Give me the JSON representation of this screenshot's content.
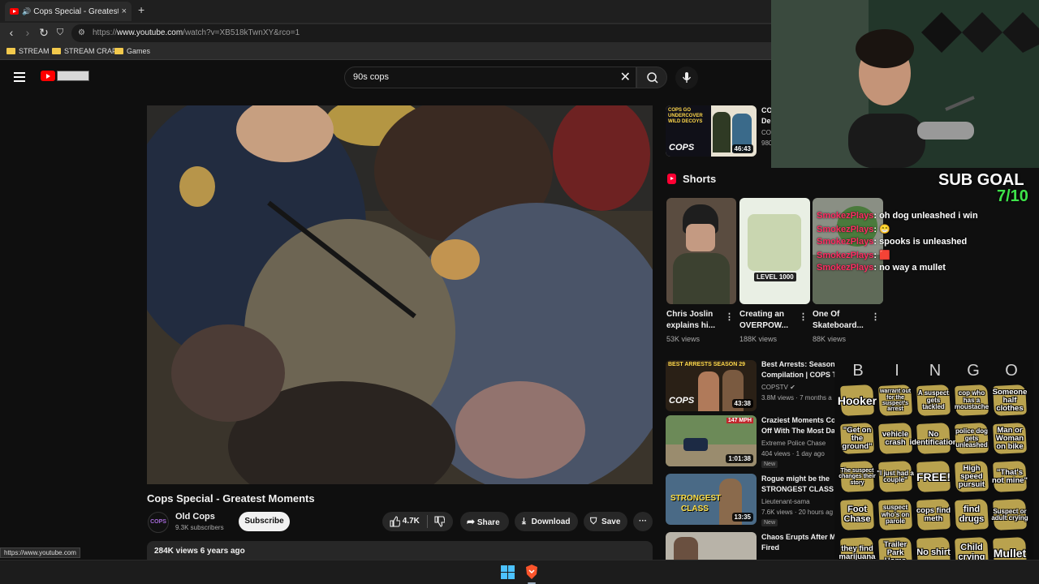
{
  "browser": {
    "tab_title": "Cops Special - Greatest Mom",
    "tab_close": "×",
    "new_tab": "+",
    "url_scheme": "https://",
    "url_host": "www.youtube.com",
    "url_path": "/watch?v=XB518kTwnXY&rco=1",
    "bookmarks": [
      "STREAM",
      "STREAM CRAP",
      "Games"
    ],
    "status_url": "https://www.youtube.com"
  },
  "youtube": {
    "search_query": "90s cops",
    "video_title": "Cops Special - Greatest Moments",
    "channel_avatar_text": "COPS",
    "channel_name": "Old Cops",
    "subscribers": "9.3K subscribers",
    "subscribe_label": "Subscribe",
    "likes": "4.7K",
    "share_label": "Share",
    "download_label": "Download",
    "save_label": "Save",
    "more_label": "···",
    "views_date": "284K views  6 years ago"
  },
  "sidebar": {
    "top_video": {
      "title": "CO",
      "line2": "De",
      "meta1": "CO",
      "meta2": "980",
      "duration": "46:43",
      "thumb_text": "COPS GO UNDERCOVER WILD DECOYS",
      "thumb_logo": "COPS"
    },
    "shorts_label": "Shorts",
    "shorts": [
      {
        "title": "Chris Joslin explains hi...",
        "views": "53K views"
      },
      {
        "title": "Creating an OVERPOW...",
        "views": "188K views",
        "thumb_text": "LEVEL 1000"
      },
      {
        "title": "One Of Skateboard...",
        "views": "88K views"
      }
    ],
    "videos": [
      {
        "title1": "Best Arrests: Season",
        "title2": "Compilation | COPS T",
        "channel": "COPSTV",
        "meta": "3.8M views · 7 months a",
        "duration": "43:38",
        "thumb_text": "BEST ARRESTS SEASON 29",
        "thumb_logo": "COPS",
        "new": ""
      },
      {
        "title1": "Craziest Moments Co",
        "title2": "Off With The Most Da",
        "channel": "Extreme Police Chase",
        "meta": "404 views · 1 day ago",
        "duration": "1:01:38",
        "thumb_text": "147 MPH",
        "new": "New"
      },
      {
        "title1": "Rogue might be the",
        "title2": "STRONGEST CLASS n",
        "channel": "Lieutenant-sama",
        "meta": "7.6K views · 20 hours ag",
        "duration": "13:35",
        "thumb_text": "STRONGEST CLASS",
        "new": "New"
      },
      {
        "title1": "Chaos Erupts After M",
        "title2": "Fired",
        "channel": "",
        "meta": "",
        "duration": "",
        "new": ""
      }
    ]
  },
  "stream": {
    "sub_goal_label": "SUB GOAL",
    "sub_goal_count": "7/10",
    "chat": [
      {
        "name": "SmokezPlays",
        "message": "oh dog unleashed i win"
      },
      {
        "name": "SmokezPlays",
        "message": "😁"
      },
      {
        "name": "SmokezPlays",
        "message": "spooks is unleashed"
      },
      {
        "name": "SmokezPlays",
        "message": "🟥"
      },
      {
        "name": "SmokezPlays",
        "message": "no way a mullet"
      }
    ],
    "chat_separator": ":"
  },
  "bingo": {
    "letters": [
      "B",
      "I",
      "N",
      "G",
      "O"
    ],
    "cells": [
      [
        "Hooker",
        "warrant out for the suspect's arrest",
        "A suspect gets tackled",
        "cop who has a moustache",
        "Someone half clothes"
      ],
      [
        "\"Get on the ground\"",
        "vehicle crash",
        "No identification",
        "police dog gets unleashed",
        "Man or Woman on bike"
      ],
      [
        "The suspect changes their story",
        "\"I just had a couple\"",
        "FREE!",
        "High speed pursuit",
        "\"That's not mine\""
      ],
      [
        "Foot Chase",
        "suspect who's on parole",
        "cops find meth",
        "find drugs",
        "Suspect or adult crying"
      ],
      [
        "they find marijuana",
        "Trailer Park Home",
        "No shirt",
        "Child crying",
        "Mullet"
      ]
    ]
  },
  "colors": {
    "accent": "#ff0000",
    "bingo_mark": "#b9a24e",
    "chat_name": "#ff2c62",
    "sub_count": "#3ee34a"
  }
}
